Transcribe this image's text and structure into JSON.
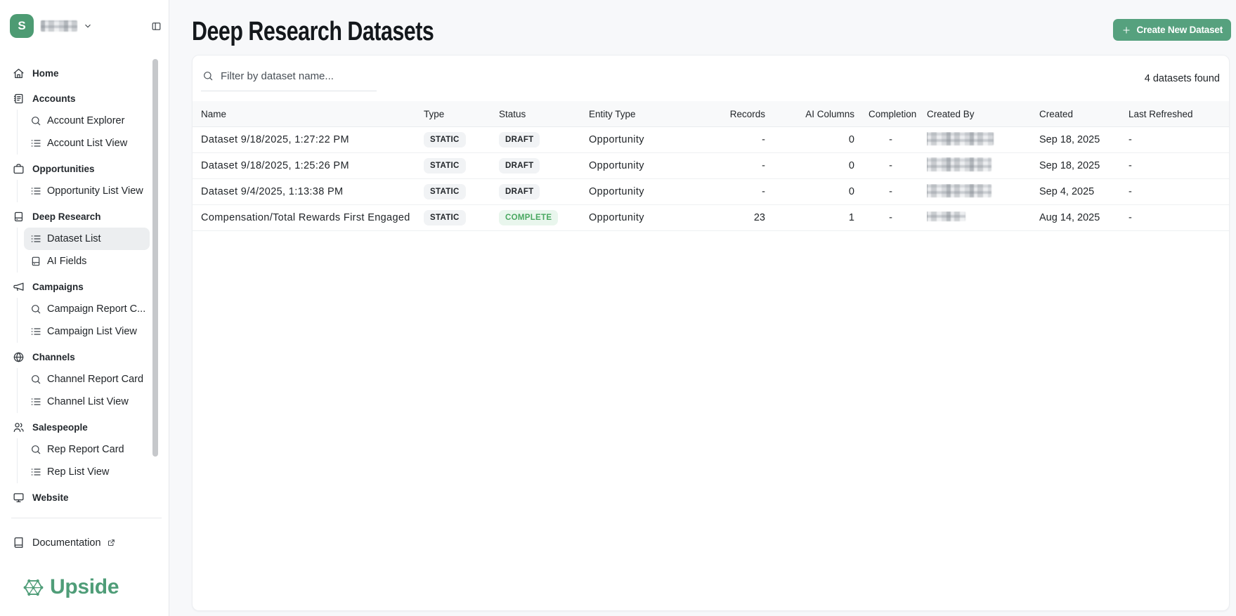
{
  "sidebar": {
    "workspace_initial": "S",
    "nav": [
      {
        "type": "top",
        "icon": "home",
        "label": "Home"
      },
      {
        "type": "top",
        "icon": "notebook",
        "label": "Accounts"
      },
      {
        "type": "sub",
        "icon": "search",
        "label": "Account Explorer"
      },
      {
        "type": "sub",
        "icon": "list",
        "label": "Account List View"
      },
      {
        "type": "top",
        "icon": "briefcase",
        "label": "Opportunities"
      },
      {
        "type": "sub",
        "icon": "list",
        "label": "Opportunity List View"
      },
      {
        "type": "top",
        "icon": "database",
        "label": "Deep Research"
      },
      {
        "type": "sub",
        "icon": "list",
        "label": "Dataset List",
        "active": true
      },
      {
        "type": "sub",
        "icon": "database",
        "label": "AI Fields"
      },
      {
        "type": "top",
        "icon": "megaphone",
        "label": "Campaigns"
      },
      {
        "type": "sub",
        "icon": "search",
        "label": "Campaign Report C..."
      },
      {
        "type": "sub",
        "icon": "list",
        "label": "Campaign List View"
      },
      {
        "type": "top",
        "icon": "globe",
        "label": "Channels"
      },
      {
        "type": "sub",
        "icon": "search",
        "label": "Channel Report Card"
      },
      {
        "type": "sub",
        "icon": "list",
        "label": "Channel List View"
      },
      {
        "type": "top",
        "icon": "users",
        "label": "Salespeople"
      },
      {
        "type": "sub",
        "icon": "search",
        "label": "Rep Report Card"
      },
      {
        "type": "sub",
        "icon": "list",
        "label": "Rep List View"
      },
      {
        "type": "top",
        "icon": "monitor",
        "label": "Website"
      }
    ],
    "documentation_label": "Documentation",
    "brand": "Upside"
  },
  "header": {
    "title": "Deep Research Datasets",
    "create_button_label": "Create New Dataset"
  },
  "toolbar": {
    "filter_placeholder": "Filter by dataset name...",
    "results_count": "4 datasets found"
  },
  "table": {
    "columns": [
      "Name",
      "Type",
      "Status",
      "Entity Type",
      "Records",
      "AI Columns",
      "Completion",
      "Created By",
      "Created",
      "Last Refreshed"
    ],
    "rows": [
      {
        "name": "Dataset 9/18/2025, 1:27:22 PM",
        "type": "STATIC",
        "status": "DRAFT",
        "entity_type": "Opportunity",
        "records": "-",
        "ai_columns": "0",
        "completion": "-",
        "created": "Sep 18, 2025",
        "last_refreshed": "-"
      },
      {
        "name": "Dataset 9/18/2025, 1:25:26 PM",
        "type": "STATIC",
        "status": "DRAFT",
        "entity_type": "Opportunity",
        "records": "-",
        "ai_columns": "0",
        "completion": "-",
        "created": "Sep 18, 2025",
        "last_refreshed": "-"
      },
      {
        "name": "Dataset 9/4/2025, 1:13:38 PM",
        "type": "STATIC",
        "status": "DRAFT",
        "entity_type": "Opportunity",
        "records": "-",
        "ai_columns": "0",
        "completion": "-",
        "created": "Sep 4, 2025",
        "last_refreshed": "-"
      },
      {
        "name": "Compensation/Total Rewards First Engaged",
        "type": "STATIC",
        "status": "COMPLETE",
        "entity_type": "Opportunity",
        "records": "23",
        "ai_columns": "1",
        "completion": "-",
        "created": "Aug 14, 2025",
        "last_refreshed": "-"
      }
    ]
  },
  "colors": {
    "brand_green": "#4f9d78",
    "button_green": "#56a17e",
    "complete_badge_bg": "#e9f6ed",
    "complete_badge_text": "#49a860",
    "badge_bg": "#f1f3f5"
  }
}
